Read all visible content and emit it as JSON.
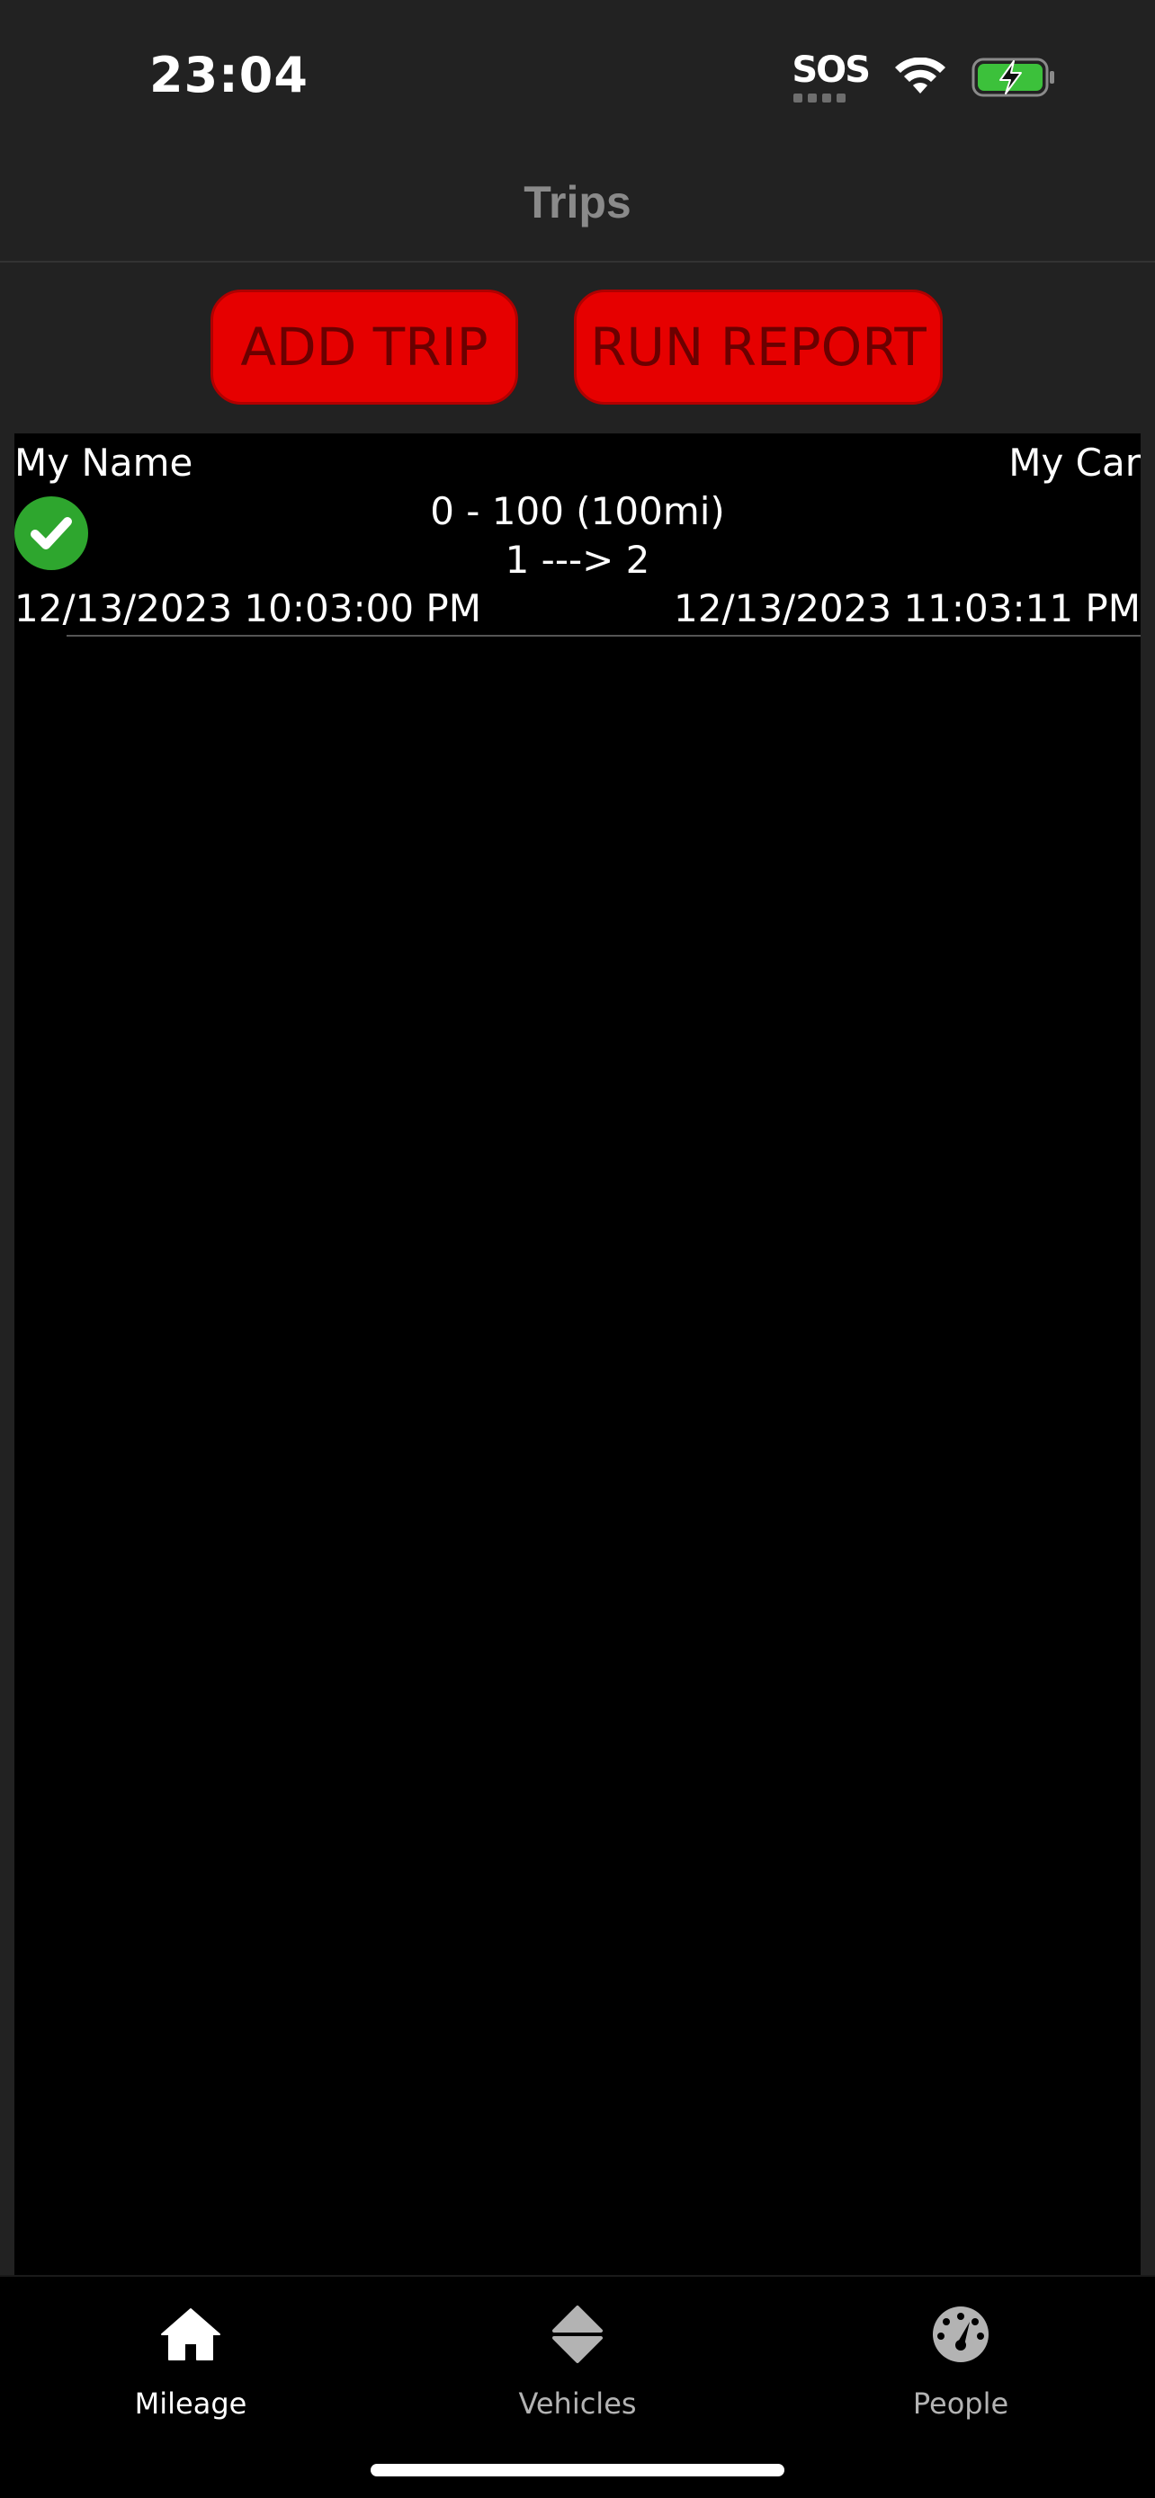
{
  "status_bar": {
    "time": "23:04",
    "sos": "SOS",
    "icons": [
      "wifi-icon",
      "battery-charging-icon"
    ],
    "battery_color": "#3cc13b"
  },
  "nav": {
    "title": "Trips"
  },
  "actions": {
    "add_trip": "ADD TRIP",
    "run_report": "RUN REPORT",
    "button_color": "#e60000"
  },
  "trips": [
    {
      "driver": "My Name",
      "vehicle": "My Car",
      "odometer": "0 - 100 (100mi)",
      "route": "1 ---> 2",
      "start": "12/13/2023 10:03:00 PM",
      "end": "12/13/2023 11:03:11 PM",
      "status_icon": "check-circle-icon",
      "status_color": "#2ea62e"
    }
  ],
  "tabs": [
    {
      "label": "Mileage",
      "icon": "home-icon",
      "active": true
    },
    {
      "label": "Vehicles",
      "icon": "sort-arrows-icon",
      "active": false
    },
    {
      "label": "People",
      "icon": "speedometer-icon",
      "active": false
    }
  ]
}
